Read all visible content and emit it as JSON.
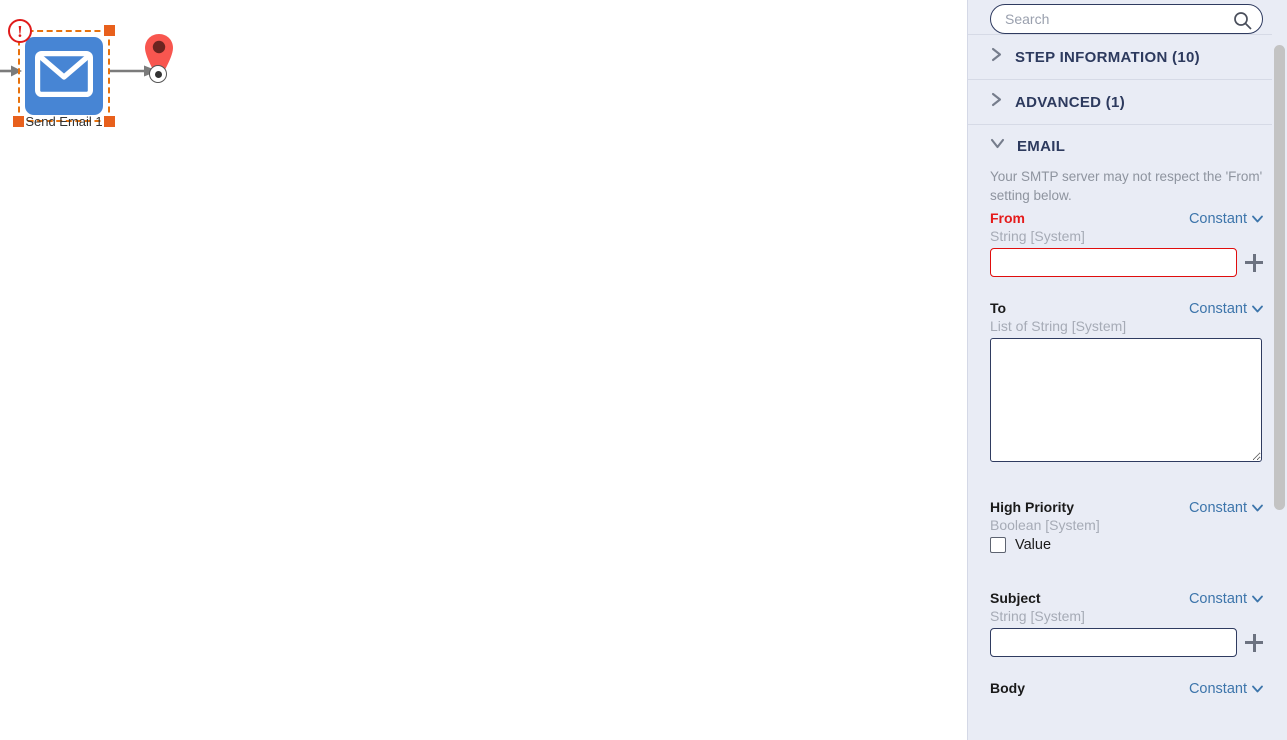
{
  "canvas": {
    "node": {
      "label": "Send Email 1",
      "icon": "envelope-icon",
      "error_badge": "!",
      "state": "selected-with-error",
      "fill_color": "#4785d4",
      "selection_color": "#e8720c"
    },
    "endpoint": {
      "icon": "map-pin-icon",
      "color": "#f8564f"
    }
  },
  "panel": {
    "search": {
      "placeholder": "Search",
      "value": "",
      "icon": "search-icon"
    },
    "sections": [
      {
        "title": "STEP INFORMATION (10)",
        "expanded": false,
        "icon": "chevron-right-icon"
      },
      {
        "title": "ADVANCED (1)",
        "expanded": false,
        "icon": "chevron-right-icon"
      },
      {
        "title": "EMAIL",
        "expanded": true,
        "icon": "chevron-down-icon"
      }
    ],
    "email": {
      "helper_text": "Your SMTP server may not respect the 'From' setting below.",
      "fields": [
        {
          "label": "From",
          "required": true,
          "mode": "Constant",
          "type": "String [System]",
          "control": "text",
          "value": "",
          "has_plus": true,
          "error": true
        },
        {
          "label": "To",
          "required": false,
          "mode": "Constant",
          "type": "List of String [System]",
          "control": "textarea",
          "value": "",
          "has_plus": false,
          "error": false
        },
        {
          "label": "High Priority",
          "required": false,
          "mode": "Constant",
          "type": "Boolean [System]",
          "control": "checkbox",
          "checkbox_label": "Value",
          "checked": false,
          "has_plus": false,
          "error": false
        },
        {
          "label": "Subject",
          "required": false,
          "mode": "Constant",
          "type": "String [System]",
          "control": "text",
          "value": "",
          "has_plus": true,
          "error": false
        },
        {
          "label": "Body",
          "required": false,
          "mode": "Constant",
          "type": "",
          "control": "none",
          "value": "",
          "has_plus": false,
          "error": false
        }
      ]
    },
    "colors": {
      "panel_bg": "#e9ecf5",
      "section_title": "#2d3a5e",
      "mode_link": "#3d75ab",
      "required_label": "#e51b1b",
      "type_text": "#a6abb6",
      "input_border": "#2f3b60",
      "error_border": "#e00d0d"
    }
  },
  "scrollbar": {
    "orientation": "vertical",
    "thumb_color": "#c3c3c3"
  }
}
